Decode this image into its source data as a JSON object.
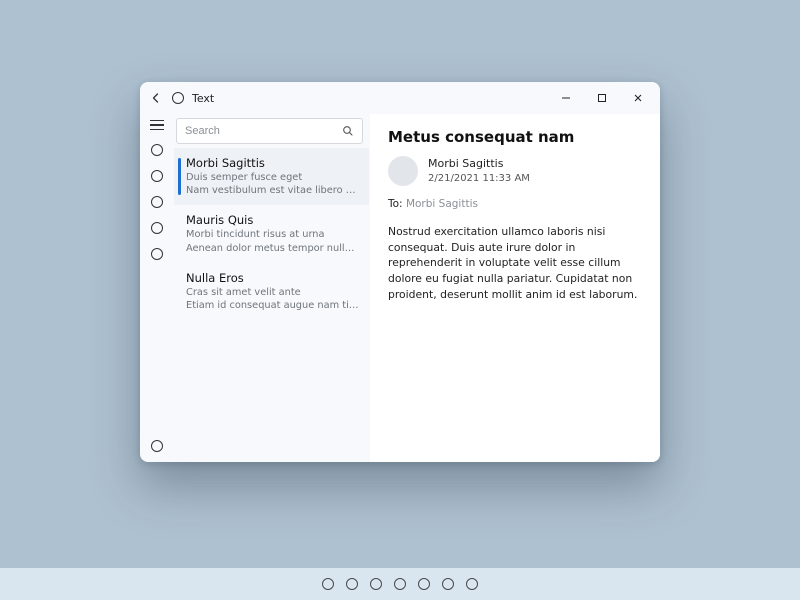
{
  "titlebar": {
    "title": "Text"
  },
  "search": {
    "placeholder": "Search"
  },
  "messages": [
    {
      "from": "Morbi Sagittis",
      "line1": "Duis semper fusce eget",
      "line2": "Nam vestibulum est vitae libero finibus et",
      "selected": true
    },
    {
      "from": "Mauris Quis",
      "line1": "Morbi tincidunt risus at urna",
      "line2": "Aenean dolor metus tempor nulla ac dapibus",
      "selected": false
    },
    {
      "from": "Nulla Eros",
      "line1": "Cras sit amet velit ante",
      "line2": "Etiam id consequat augue nam tincidunt",
      "selected": false
    }
  ],
  "detail": {
    "subject": "Metus consequat nam",
    "sender_name": "Morbi Sagittis",
    "sender_date": "2/21/2021 11:33 AM",
    "to_label": "To:",
    "to_value": "Morbi Sagittis",
    "body": "Nostrud exercitation ullamco laboris nisi consequat. Duis aute irure dolor in reprehenderit in voluptate velit esse cillum dolore eu fugiat nulla pariatur. Cupidatat non proident, deserunt mollit anim id est laborum."
  },
  "taskbar": {
    "count": 7
  }
}
